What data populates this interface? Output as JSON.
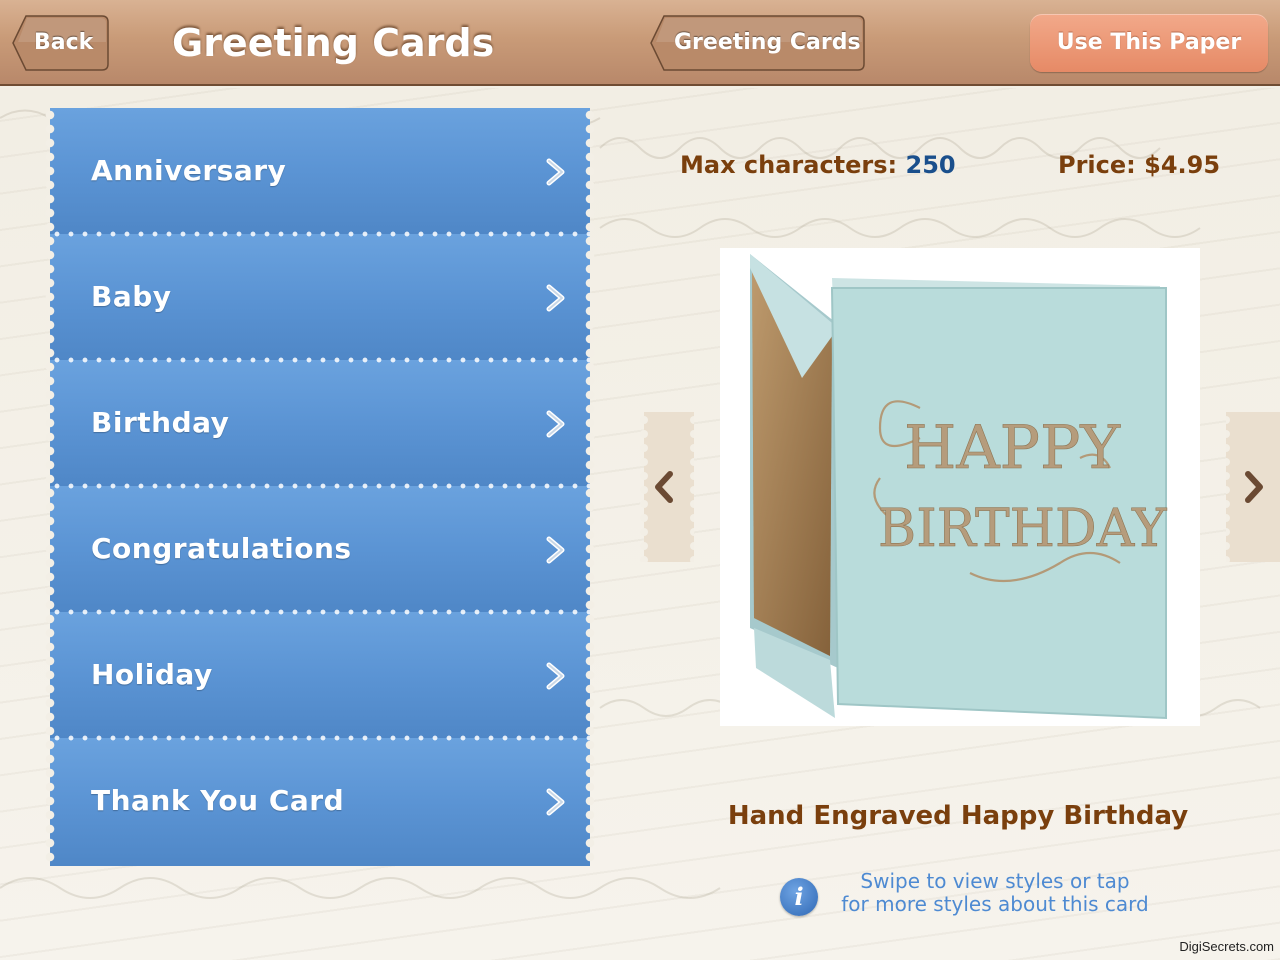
{
  "header": {
    "back_label": "Back",
    "title": "Greeting Cards",
    "breadcrumb_label": "Greeting Cards",
    "use_button_label": "Use This Paper"
  },
  "categories": [
    {
      "label": "Anniversary"
    },
    {
      "label": "Baby"
    },
    {
      "label": "Birthday"
    },
    {
      "label": "Congratulations"
    },
    {
      "label": "Holiday"
    },
    {
      "label": "Thank You Card"
    }
  ],
  "detail": {
    "max_chars_label": "Max characters:",
    "max_chars_value": "250",
    "price_label": "Price:",
    "price_value": "$4.95",
    "card_line1": "HAPPY",
    "card_line2": "BIRTHDAY",
    "card_name": "Hand Engraved Happy Birthday",
    "hint_line1": "Swipe to view styles or tap",
    "hint_line2": "for more styles about this card",
    "info_icon_glyph": "i"
  },
  "footer": {
    "credit": "DigiSecrets.com"
  },
  "colors": {
    "header": "#c99b78",
    "accent_button": "#e68a66",
    "list_blue": "#5b94d4",
    "brown_text": "#7a3f0d",
    "value_blue": "#1a4f8c",
    "card_blue": "#b8dcdb",
    "hint_blue": "#4e8ad2"
  },
  "icons": [
    "back-arrow-icon",
    "chevron-right-icon",
    "chevron-left-icon",
    "info-icon"
  ]
}
